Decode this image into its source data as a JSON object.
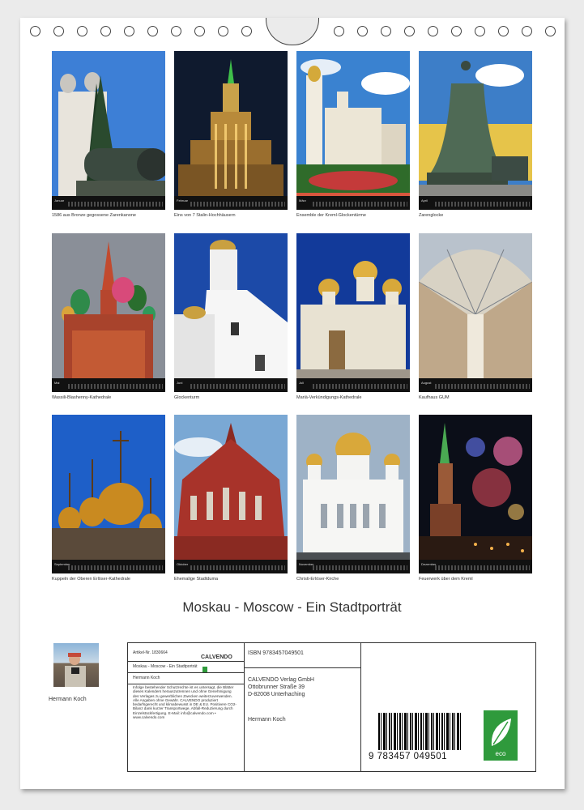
{
  "title": "Moskau - Moscow - Ein Stadtporträt",
  "months": [
    {
      "label": "Januar",
      "caption": "1586 aus Bronze gegossene Zarenkanone"
    },
    {
      "label": "Februar",
      "caption": "Eins von 7 Stalin-Hochhäusern"
    },
    {
      "label": "März",
      "caption": "Ensemble der Kreml-Glockentürme"
    },
    {
      "label": "April",
      "caption": "Zarenglocke"
    },
    {
      "label": "Mai",
      "caption": "Wassili-Blashenny-Kathedrale"
    },
    {
      "label": "Juni",
      "caption": "Glockenturm"
    },
    {
      "label": "Juli",
      "caption": "Mariä-Verkündigungs-Kathedrale"
    },
    {
      "label": "August",
      "caption": "Kaufhaus GUM"
    },
    {
      "label": "September",
      "caption": "Kuppeln der Oberen Erlöser-Kathedrale"
    },
    {
      "label": "Oktober",
      "caption": "Ehemalige Stadtduma"
    },
    {
      "label": "November",
      "caption": "Christi-Erlöser-Kirche"
    },
    {
      "label": "Dezember",
      "caption": "Feuerwerk über dem Kreml"
    }
  ],
  "author": {
    "name": "Hermann Koch"
  },
  "info": {
    "article_label": "Artikel-Nr. 1830664",
    "calvendo_logo": "CALVENDO",
    "product_title": "Moskau - Moscow - Ein Stadtporträt",
    "author": "Hermann Koch",
    "blurb": "Infolge bestehender Schutzrechte ist es untersagt, die Blätter dieses Kalenders herauszutrennen und ohne Genehmigung des Verlages zu gewerblichen Zwecken weiterzuverwenden. Alle Angaben ohne Gewähr. CALVENDO produziert bedarfsgerecht und klimabewusst in DE & EU. Positivere CO2-Bilanz dank kurzer Transportwege, Abfall-Reduzierung durch Einzelstückfertigung. E-Mail: info@calvendo.com • www.calvendo.com",
    "isbn": "ISBN 9783457049501",
    "publisher_name": "CALVENDO Verlag GmbH",
    "publisher_street": "Ottobrunner Straße 39",
    "publisher_city": "D-82008 Unterhaching",
    "publisher_author": "Hermann Koch",
    "isbn_digits": "9 783457 049501",
    "eco_label": "eco"
  },
  "colors": {
    "eco_green": "#2f9a3c",
    "sheet": "#ffffff",
    "background": "#ebebeb"
  }
}
